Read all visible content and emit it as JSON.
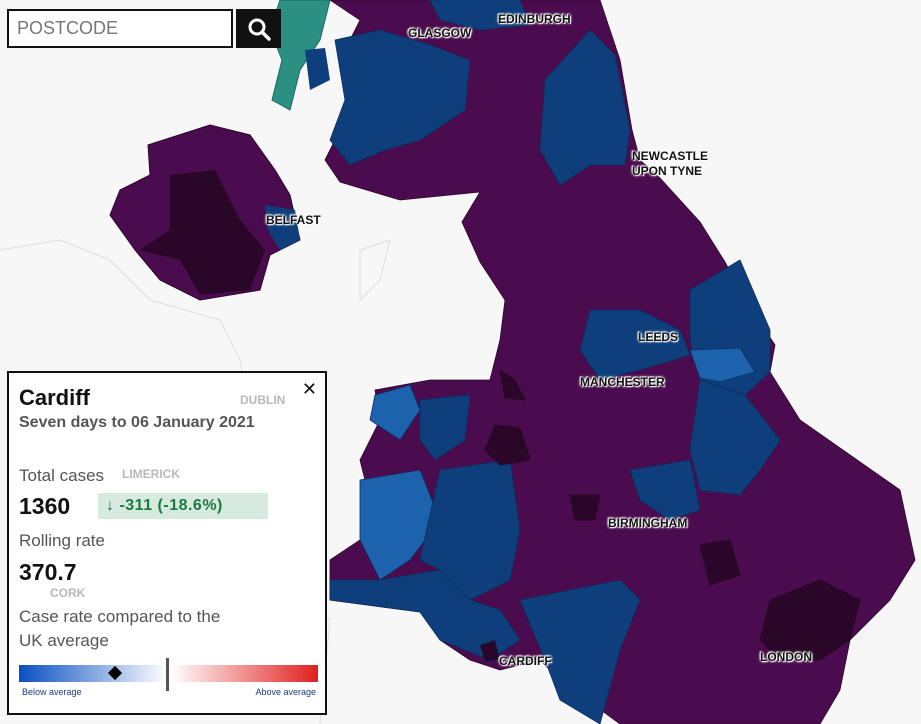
{
  "search": {
    "placeholder": "POSTCODE",
    "button_icon": "search-icon"
  },
  "map": {
    "labels": {
      "glasgow": "GLASGOW",
      "edinburgh": "EDINBURGH",
      "newcastle": "NEWCASTLE\nUPON TYNE",
      "belfast": "BELFAST",
      "leeds": "LEEDS",
      "manchester": "MANCHESTER",
      "birmingham": "BIRMINGHAM",
      "cardiff": "CARDIFF",
      "london": "LONDON",
      "dublin": "DUBLIN",
      "limerick": "LIMERICK",
      "cork": "CORK"
    },
    "colors": {
      "background": "#f7f7f7",
      "high": "#4b0c4f",
      "very_high": "#2a0628",
      "low": "#0e3f7c",
      "lower": "#1c62ad",
      "islands": "#2b8f82"
    }
  },
  "panel": {
    "area": "Cardiff",
    "period": "Seven days to 06 January 2021",
    "total_cases_label": "Total cases",
    "total_cases": "1360",
    "change": "↓ -311 (-18.6%)",
    "rolling_rate_label": "Rolling rate",
    "rolling_rate": "370.7",
    "comparison_label": "Case rate compared to the UK average",
    "below_label": "Below average",
    "above_label": "Above average",
    "comparison_position_pct": 32,
    "close_icon": "close-icon"
  }
}
